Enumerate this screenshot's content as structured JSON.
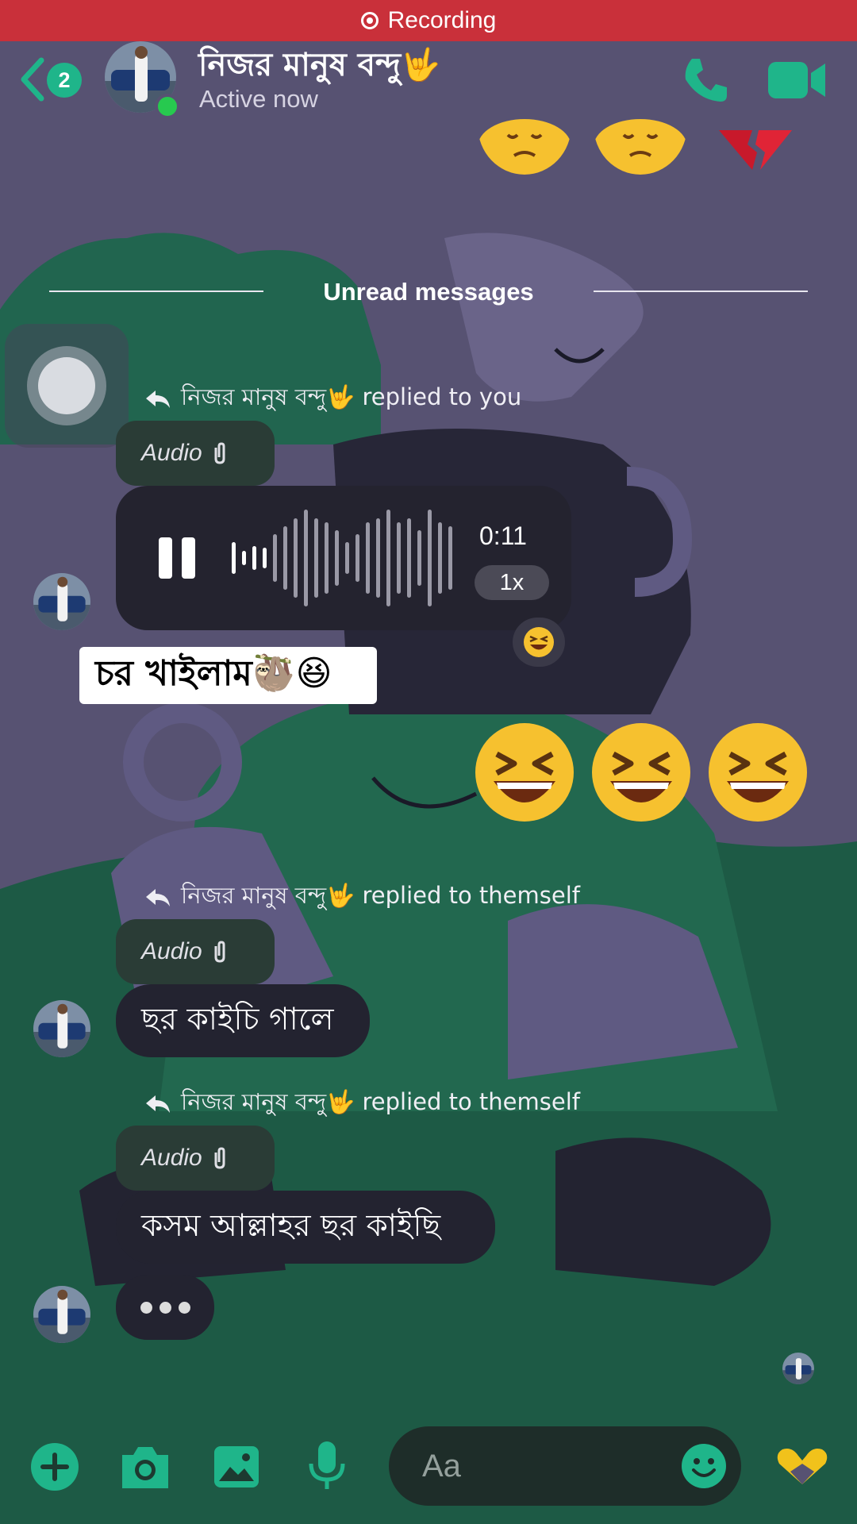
{
  "recording": {
    "label": "Recording"
  },
  "header": {
    "back_badge": "2",
    "contact_name": "নিজর মানুষ বন্দু🤟",
    "status": "Active now"
  },
  "top_emojis": [
    "😞",
    "😞",
    "💔"
  ],
  "divider": {
    "label": "Unread messages"
  },
  "messages": [
    {
      "reply_header": "নিজর মানুষ বন্দু🤟 replied to you",
      "audio_label": "Audio",
      "voice": {
        "duration": "0:11",
        "speed": "1x",
        "reaction": "😆"
      }
    },
    {
      "sticker_text": "চর খাইলাম🦥😆"
    },
    {
      "big_emojis": [
        "😆",
        "😆",
        "😆"
      ]
    },
    {
      "reply_header": "নিজর মানুষ বন্দু🤟 replied to themself",
      "audio_label": "Audio",
      "text": "ছর কাইচি গালে"
    },
    {
      "reply_header": "নিজর মানুষ বন্দু🤟 replied to themself",
      "audio_label": "Audio",
      "text": "কসম আল্লাহর ছর কাইছি"
    }
  ],
  "composer": {
    "placeholder": "Aa"
  },
  "icons": {
    "back": "chevron-left-icon",
    "call": "phone-icon",
    "video": "video-camera-icon",
    "reply": "reply-arrow-icon",
    "attach": "paperclip-icon",
    "plus": "plus-icon",
    "camera": "camera-icon",
    "gallery": "image-icon",
    "mic": "microphone-icon",
    "emoji": "smiley-icon",
    "like": "heart-hands-icon"
  },
  "colors": {
    "accent": "#1fb58a",
    "recording": "#c9303a",
    "bubble": "#232330",
    "background": "#575272"
  }
}
